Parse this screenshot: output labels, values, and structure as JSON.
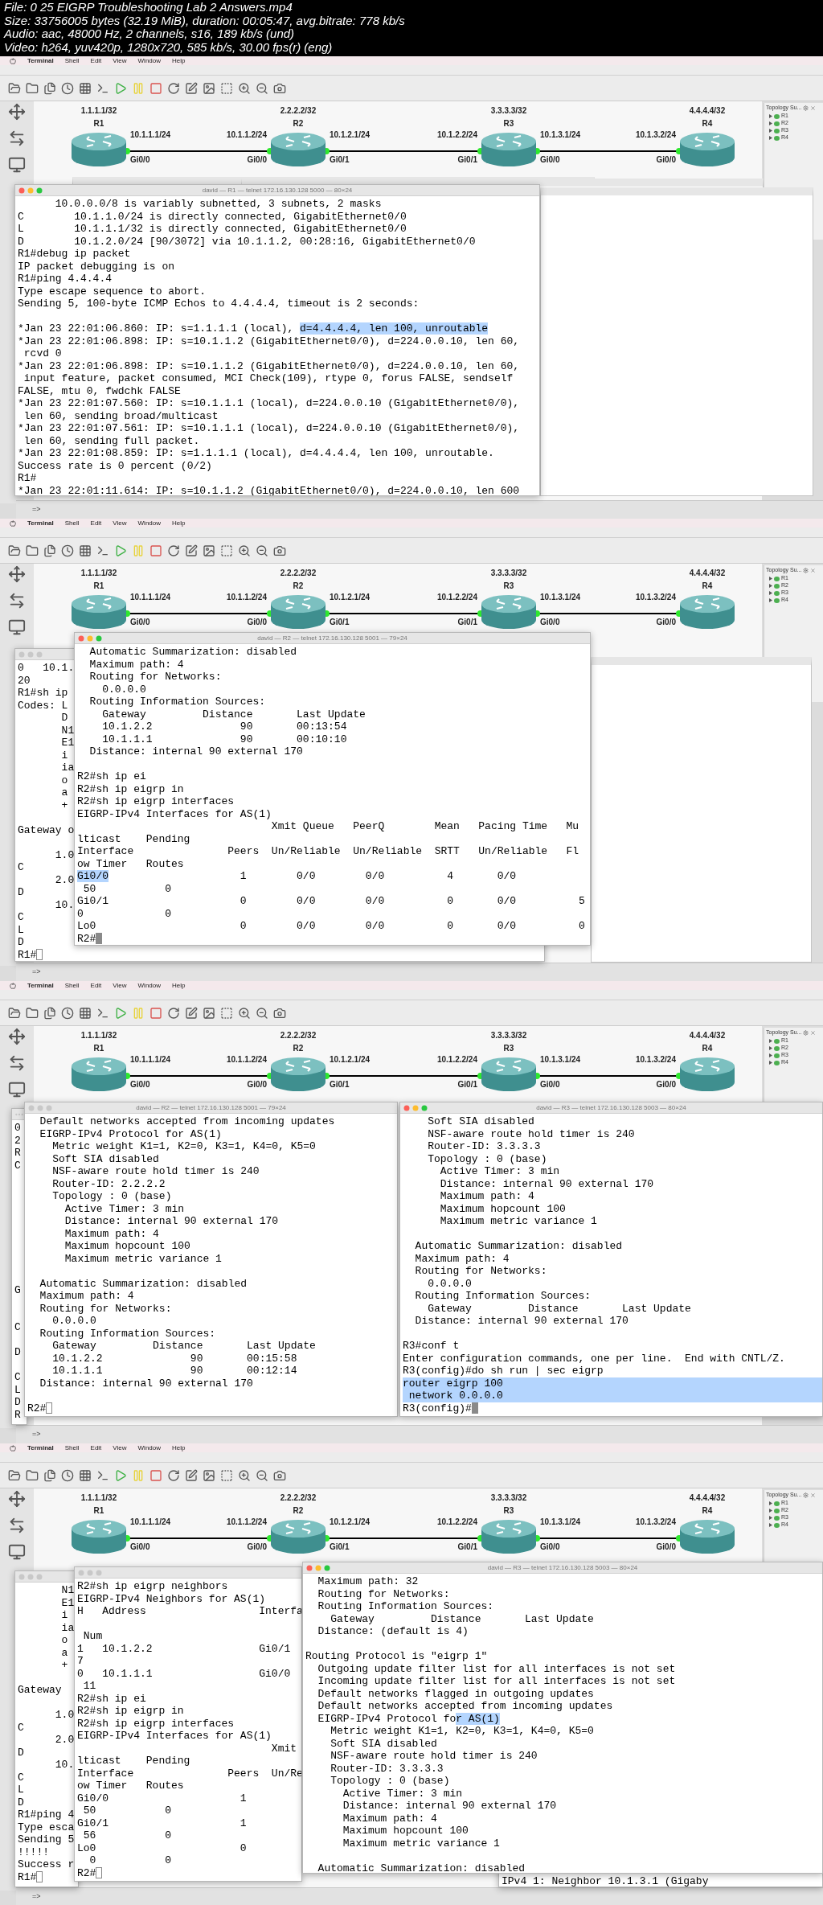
{
  "file_info": [
    "File: 0 25 EIGRP Troubleshooting Lab 2 Answers.mp4",
    "Size: 33756005 bytes (32.19 MiB), duration: 00:05:47, avg.bitrate: 778 kb/s",
    "Audio: aac, 48000 Hz, 2 channels, s16, 189 kb/s (und)",
    "Video: h264, yuv420p, 1280x720, 585 kb/s, 30.00 fps(r) (eng)"
  ],
  "frames": [
    {
      "menu_bar": {
        "app": "Terminal",
        "items": [
          "Shell",
          "Edit",
          "View",
          "Window",
          "Help"
        ]
      },
      "topology": {
        "routers": [
          {
            "name": "R1",
            "loopback": "1.1.1.1/32"
          },
          {
            "name": "R2",
            "loopback": "2.2.2.2/32"
          },
          {
            "name": "R3",
            "loopback": "3.3.3.3/32"
          },
          {
            "name": "R4",
            "loopback": "4.4.4.4/32"
          }
        ],
        "links": [
          {
            "left_ip": "10.1.1.1/24",
            "left_port": "Gi0/0",
            "right_ip": "10.1.1.2/24",
            "right_port": "Gi0/0"
          },
          {
            "left_ip": "10.1.2.1/24",
            "left_port": "Gi0/1",
            "right_ip": "10.1.2.2/24",
            "right_port": "Gi0/1"
          },
          {
            "left_ip": "10.1.3.1/24",
            "left_port": "Gi0/0",
            "right_ip": "10.1.3.2/24",
            "right_port": "Gi0/0"
          }
        ]
      },
      "summary": {
        "title": "Topology Su...",
        "items": [
          "R1",
          "R2",
          "R3",
          "R4"
        ]
      },
      "windows": [
        {
          "title": "david — R1 — telnet 172.16.130.128 5000 — 80×24",
          "active": true,
          "lines": [
            "      10.0.0.0/8 is variably subnetted, 3 subnets, 2 masks",
            "C        10.1.1.0/24 is directly connected, GigabitEthernet0/0",
            "L        10.1.1.1/32 is directly connected, GigabitEthernet0/0",
            "D        10.1.2.0/24 [90/3072] via 10.1.1.2, 00:28:16, GigabitEthernet0/0",
            "R1#debug ip packet",
            "IP packet debugging is on",
            "R1#ping 4.4.4.4",
            "Type escape sequence to abort.",
            "Sending 5, 100-byte ICMP Echos to 4.4.4.4, timeout is 2 seconds:",
            {
              "kind": "blank"
            },
            {
              "kind": "part_selected",
              "before": "*Jan 23 22:01:06.860: IP: s=1.1.1.1 (local), ",
              "selected_text": "d=4.4.4.4, len 100, unroutable"
            },
            "*Jan 23 22:01:06.898: IP: s=10.1.1.2 (GigabitEthernet0/0), d=224.0.0.10, len 60,",
            " rcvd 0",
            "*Jan 23 22:01:06.898: IP: s=10.1.1.2 (GigabitEthernet0/0), d=224.0.0.10, len 60,",
            " input feature, packet consumed, MCI Check(109), rtype 0, forus FALSE, sendself",
            "FALSE, mtu 0, fwdchk FALSE",
            "*Jan 23 22:01:07.560: IP: s=10.1.1.1 (local), d=224.0.0.10 (GigabitEthernet0/0),",
            " len 60, sending broad/multicast",
            "*Jan 23 22:01:07.561: IP: s=10.1.1.1 (local), d=224.0.0.10 (GigabitEthernet0/0),",
            " len 60, sending full packet.",
            "*Jan 23 22:01:08.859: IP: s=1.1.1.1 (local), d=4.4.4.4, len 100, unroutable.",
            "Success rate is 0 percent (0/2)",
            "R1#",
            "*Jan 23 22:01:11.614: IP: s=10.1.1.2 (GigabitEthernet0/0), d=224.0.0.10, len 600"
          ]
        }
      ],
      "console": "=>"
    },
    {
      "menu_bar": {
        "app": "Terminal",
        "items": [
          "Shell",
          "Edit",
          "View",
          "Window",
          "Help"
        ]
      },
      "topology": {
        "routers": [
          {
            "name": "R1",
            "loopback": "1.1.1.1/32"
          },
          {
            "name": "R2",
            "loopback": "2.2.2.2/32"
          },
          {
            "name": "R3",
            "loopback": "3.3.3.3/32"
          },
          {
            "name": "R4",
            "loopback": "4.4.4.4/32"
          }
        ],
        "links": [
          {
            "left_ip": "10.1.1.1/24",
            "left_port": "Gi0/0",
            "right_ip": "10.1.1.2/24",
            "right_port": "Gi0/0"
          },
          {
            "left_ip": "10.1.2.1/24",
            "left_port": "Gi0/1",
            "right_ip": "10.1.2.2/24",
            "right_port": "Gi0/1"
          },
          {
            "left_ip": "10.1.3.1/24",
            "left_port": "Gi0/0",
            "right_ip": "10.1.3.2/24",
            "right_port": "Gi0/0"
          }
        ]
      },
      "summary": {
        "title": "Topology Su...",
        "items": [
          "R1",
          "R2",
          "R3",
          "R4"
        ]
      },
      "windows": [
        {
          "active": false,
          "cursor": {
            "kind": "hollow"
          },
          "lines": [
            "0   10.1.",
            "20",
            "R1#sh ip",
            "Codes: L",
            "       D",
            "       N1",
            "       E1",
            "       i",
            "       ia",
            "       o",
            "       a",
            "       +",
            {
              "kind": "blank"
            },
            "Gateway o",
            {
              "kind": "blank"
            },
            "      1.0",
            "C",
            "      2.0",
            "D",
            "      10.",
            "C",
            "L",
            "D",
            "R1#"
          ]
        },
        {
          "title": "david — R2 — telnet 172.16.130.128 5001 — 79×24",
          "active": true,
          "cursor": {
            "kind": "solid"
          },
          "lines": [
            "  Automatic Summarization: disabled",
            "  Maximum path: 4",
            "  Routing for Networks:",
            "    0.0.0.0",
            "  Routing Information Sources:",
            "    Gateway         Distance       Last Update",
            "    10.1.2.2              90       00:13:54",
            "    10.1.1.1              90       00:10:10",
            "  Distance: internal 90 external 170",
            {
              "kind": "blank"
            },
            "R2#sh ip ei",
            "R2#sh ip eigrp in",
            "R2#sh ip eigrp interfaces",
            "EIGRP-IPv4 Interfaces for AS(1)",
            "                               Xmit Queue   PeerQ        Mean   Pacing Time   Mu",
            "lticast    Pending",
            "Interface               Peers  Un/Reliable  Un/Reliable  SRTT   Un/Reliable   Fl",
            "ow Timer   Routes",
            {
              "kind": "part_selected",
              "selected_text": "Gi0/0",
              "after": "                     1        0/0        0/0          4       0/0"
            },
            " 50           0",
            "Gi0/1                     0        0/0        0/0          0       0/0          5",
            "0             0",
            "Lo0                       0        0/0        0/0          0       0/0          0",
            "R2#"
          ]
        }
      ],
      "console": "=>"
    },
    {
      "menu_bar": {
        "app": "Terminal",
        "items": [
          "Shell",
          "Edit",
          "View",
          "Window",
          "Help"
        ]
      },
      "topology": {
        "routers": [
          {
            "name": "R1",
            "loopback": "1.1.1.1/32"
          },
          {
            "name": "R2",
            "loopback": "2.2.2.2/32"
          },
          {
            "name": "R3",
            "loopback": "3.3.3.3/32"
          },
          {
            "name": "R4",
            "loopback": "4.4.4.4/32"
          }
        ],
        "links": [
          {
            "left_ip": "10.1.1.1/24",
            "left_port": "Gi0/0",
            "right_ip": "10.1.1.2/24",
            "right_port": "Gi0/0"
          },
          {
            "left_ip": "10.1.2.1/24",
            "left_port": "Gi0/1",
            "right_ip": "10.1.2.2/24",
            "right_port": "Gi0/1"
          },
          {
            "left_ip": "10.1.3.1/24",
            "left_port": "Gi0/0",
            "right_ip": "10.1.3.2/24",
            "right_port": "Gi0/0"
          }
        ]
      },
      "summary": {
        "title": "Topology Su...",
        "items": [
          "R1",
          "R2",
          "R3",
          "R4"
        ]
      },
      "windows": [
        {
          "lines": [
            "0",
            "2",
            "R",
            "C",
            {
              "kind": "blank"
            },
            {
              "kind": "blank"
            },
            {
              "kind": "blank"
            },
            {
              "kind": "blank"
            },
            {
              "kind": "blank"
            },
            {
              "kind": "blank"
            },
            {
              "kind": "blank"
            },
            {
              "kind": "blank"
            },
            {
              "kind": "blank"
            },
            "G",
            {
              "kind": "blank"
            },
            {
              "kind": "blank"
            },
            "C",
            {
              "kind": "blank"
            },
            "D",
            {
              "kind": "blank"
            },
            "C",
            "L",
            "D",
            "R"
          ]
        },
        {
          "title": "david — R2 — telnet 172.16.130.128 5001 — 79×24",
          "active": false,
          "cursor": {
            "kind": "hollow"
          },
          "lines": [
            "  Default networks accepted from incoming updates",
            "  EIGRP-IPv4 Protocol for AS(1)",
            "    Metric weight K1=1, K2=0, K3=1, K4=0, K5=0",
            "    Soft SIA disabled",
            "    NSF-aware route hold timer is 240",
            "    Router-ID: 2.2.2.2",
            "    Topology : 0 (base)",
            "      Active Timer: 3 min",
            "      Distance: internal 90 external 170",
            "      Maximum path: 4",
            "      Maximum hopcount 100",
            "      Maximum metric variance 1",
            {
              "kind": "blank"
            },
            "  Automatic Summarization: disabled",
            "  Maximum path: 4",
            "  Routing for Networks:",
            "    0.0.0.0",
            "  Routing Information Sources:",
            "    Gateway         Distance       Last Update",
            "    10.1.2.2              90       00:15:58",
            "    10.1.1.1              90       00:12:14",
            "  Distance: internal 90 external 170",
            {
              "kind": "blank"
            },
            "R2#"
          ]
        },
        {
          "title": "david — R3 — telnet 172.16.130.128 5003 — 80×24",
          "active": true,
          "cursor": {
            "kind": "solid"
          },
          "lines": [
            "    Soft SIA disabled",
            "    NSF-aware route hold timer is 240",
            "    Router-ID: 3.3.3.3",
            "    Topology : 0 (base)",
            "      Active Timer: 3 min",
            "      Distance: internal 90 external 170",
            "      Maximum path: 4",
            "      Maximum hopcount 100",
            "      Maximum metric variance 1",
            {
              "kind": "blank"
            },
            "  Automatic Summarization: disabled",
            "  Maximum path: 4",
            "  Routing for Networks:",
            "    0.0.0.0",
            "  Routing Information Sources:",
            "    Gateway         Distance       Last Update",
            "  Distance: internal 90 external 170",
            {
              "kind": "blank"
            },
            "R3#conf t",
            "Enter configuration commands, one per line.  End with CNTL/Z.",
            "R3(config)#do sh run | sec eigrp",
            {
              "kind": "line_selected",
              "text": "router eigrp 100"
            },
            {
              "kind": "line_selected",
              "text": " network 0.0.0.0"
            },
            "R3(config)#"
          ]
        }
      ],
      "console": "=>"
    },
    {
      "menu_bar": {
        "app": "Terminal",
        "items": [
          "Shell",
          "Edit",
          "View",
          "Window",
          "Help"
        ]
      },
      "topology": {
        "routers": [
          {
            "name": "R1",
            "loopback": "1.1.1.1/32"
          },
          {
            "name": "R2",
            "loopback": "2.2.2.2/32"
          },
          {
            "name": "R3",
            "loopback": "3.3.3.3/32"
          },
          {
            "name": "R4",
            "loopback": "4.4.4.4/32"
          }
        ],
        "links": [
          {
            "left_ip": "10.1.1.1/24",
            "left_port": "Gi0/0",
            "right_ip": "10.1.1.2/24",
            "right_port": "Gi0/0"
          },
          {
            "left_ip": "10.1.2.1/24",
            "left_port": "Gi0/1",
            "right_ip": "10.1.2.2/24",
            "right_port": "Gi0/1"
          },
          {
            "left_ip": "10.1.3.1/24",
            "left_port": "Gi0/0",
            "right_ip": "10.1.3.2/24",
            "right_port": "Gi0/0"
          }
        ]
      },
      "summary": {
        "title": "Topology Su...",
        "items": [
          "R1",
          "R2",
          "R3",
          "R4"
        ]
      },
      "windows": [
        {
          "active": false,
          "cursor": {
            "kind": "hollow"
          },
          "lines": [
            "       N1",
            "       E1",
            "       i",
            "       ia",
            "       o",
            "       a",
            "       +",
            {
              "kind": "blank"
            },
            "Gateway",
            {
              "kind": "blank"
            },
            "      1.0",
            "C",
            "      2.0",
            "D",
            "      10.",
            "C",
            "L",
            "D",
            "R1#ping 4",
            "Type esca",
            "Sending 5",
            "!!!!!",
            "Success r",
            "R1#"
          ]
        },
        {
          "active": false,
          "cursor": {
            "kind": "hollow"
          },
          "lines": [
            "R2#sh ip eigrp neighbors",
            "EIGRP-IPv4 Neighbors for AS(1)",
            "H   Address                  Interfa",
            {
              "kind": "blank"
            },
            " Num",
            "1   10.1.2.2                 Gi0/1",
            "7",
            "0   10.1.1.1                 Gi0/0",
            " 11",
            "R2#sh ip ei",
            "R2#sh ip eigrp in",
            "R2#sh ip eigrp interfaces",
            "EIGRP-IPv4 Interfaces for AS(1)",
            "                               Xmit",
            "lticast    Pending",
            "Interface               Peers  Un/Re",
            "ow Timer   Routes",
            "Gi0/0                     1",
            " 50           0",
            "Gi0/1                     1",
            " 56           0",
            "Lo0                       0",
            "  0           0",
            "R2#"
          ]
        },
        {
          "lines": [
            "IPv4 1: Neighbor 10.1.3.1 (Gigaby"
          ]
        },
        {
          "title": "david — R3 — telnet 172.16.130.128 5003 — 80×24",
          "active": true,
          "lines": [
            "  Maximum path: 32",
            "  Routing for Networks:",
            "  Routing Information Sources:",
            "    Gateway         Distance       Last Update",
            "  Distance: (default is 4)",
            {
              "kind": "blank"
            },
            "Routing Protocol is \"eigrp 1\"",
            "  Outgoing update filter list for all interfaces is not set",
            "  Incoming update filter list for all interfaces is not set",
            "  Default networks flagged in outgoing updates",
            "  Default networks accepted from incoming updates",
            {
              "kind": "part_selected",
              "before": "  EIGRP-IPv4 Protocol fo",
              "selected_text": "r AS(1)"
            },
            "    Metric weight K1=1, K2=0, K3=1, K4=0, K5=0",
            "    Soft SIA disabled",
            "    NSF-aware route hold timer is 240",
            "    Router-ID: 3.3.3.3",
            "    Topology : 0 (base)",
            "      Active Timer: 3 min",
            "      Distance: internal 90 external 170",
            "      Maximum path: 4",
            "      Maximum hopcount 100",
            "      Maximum metric variance 1",
            {
              "kind": "blank"
            },
            "  Automatic Summarization: disabled"
          ]
        }
      ],
      "console": "=>"
    }
  ]
}
